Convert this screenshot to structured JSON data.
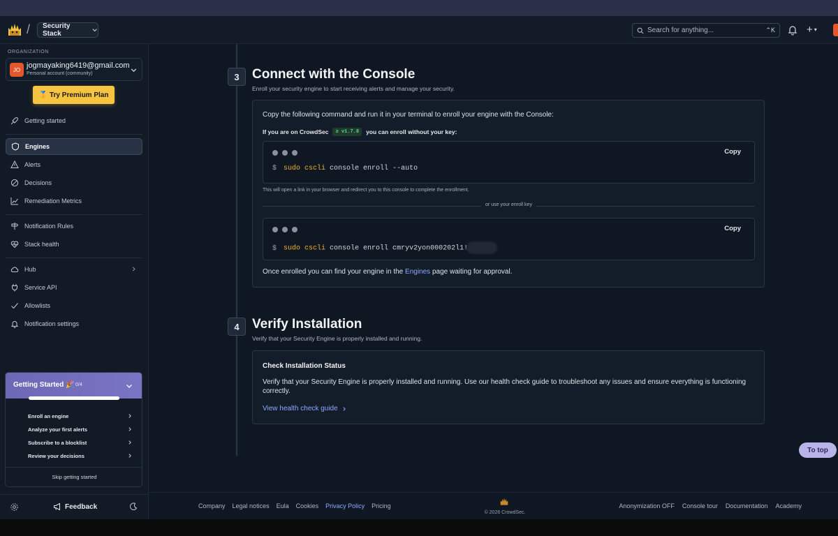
{
  "header": {
    "stack_label": "Security Stack",
    "search_placeholder": "Search for anything...",
    "search_shortcut": "⌃K"
  },
  "sidebar": {
    "org_label": "ORGANIZATION",
    "account_email": "jogmayaking6419@gmail.com",
    "account_type": "Personal account (community)",
    "avatar_initials": "JO",
    "premium_label": "Try Premium Plan",
    "getting_started": "Getting started",
    "items": {
      "engines": "Engines",
      "alerts": "Alerts",
      "decisions": "Decisions",
      "remediation_metrics": "Remediation Metrics",
      "notification_rules": "Notification Rules",
      "stack_health": "Stack health",
      "hub": "Hub",
      "service_api": "Service API",
      "allowlists": "Allowlists",
      "notification_settings": "Notification settings"
    },
    "gs_card": {
      "title": "Getting Started 🎉",
      "count": "0/4",
      "progress": 0,
      "steps": [
        "Enroll an engine",
        "Analyze your first alerts",
        "Subscribe to a blocklist",
        "Review your decisions"
      ],
      "skip": "Skip getting started"
    },
    "feedback": "Feedback"
  },
  "main": {
    "step3": {
      "number": "3",
      "title": "Connect with the Console",
      "subtitle": "Enroll your security engine to start receiving alerts and manage your security.",
      "intro": "Copy the following command and run it in your terminal to enroll your engine with the Console:",
      "crowdsec_prefix": "If you are on CrowdSec",
      "version": "≥ v1.7.8",
      "crowdsec_suffix": "you can enroll without your key:",
      "copy_label": "Copy",
      "prompt": "$",
      "cmd_keyword": "sudo cscli",
      "cmd_auto_rest": "console enroll --auto",
      "note": "This will open a link in your browser and redirect you to this console to complete the enrollment.",
      "or_text": "or use your enroll key",
      "cmd_key_rest": "console enroll cmryv2yon000202l1!",
      "enrolled_prefix": "Once enrolled you can find your engine in the",
      "enrolled_link": "Engines",
      "enrolled_suffix": "page waiting for approval."
    },
    "step4": {
      "number": "4",
      "title": "Verify Installation",
      "subtitle": "Verify that your Security Engine is properly installed and running.",
      "card_title": "Check Installation Status",
      "card_desc": "Verify that your Security Engine is properly installed and running. Use our health check guide to troubleshoot any issues and ensure everything is functioning correctly.",
      "link": "View health check guide"
    },
    "to_top": "To top"
  },
  "footer": {
    "links": [
      "Company",
      "Legal notices",
      "Eula",
      "Cookies",
      "Privacy Policy",
      "Pricing"
    ],
    "copyright": "© 2026 CrowdSec.",
    "right_links": [
      "Anonymization OFF",
      "Console tour",
      "Documentation",
      "Academy"
    ]
  },
  "colors": {
    "accent": "#8ea8ff",
    "premium": "#f6c440",
    "brand_orange": "#e5562a",
    "command": "#f2b233"
  }
}
